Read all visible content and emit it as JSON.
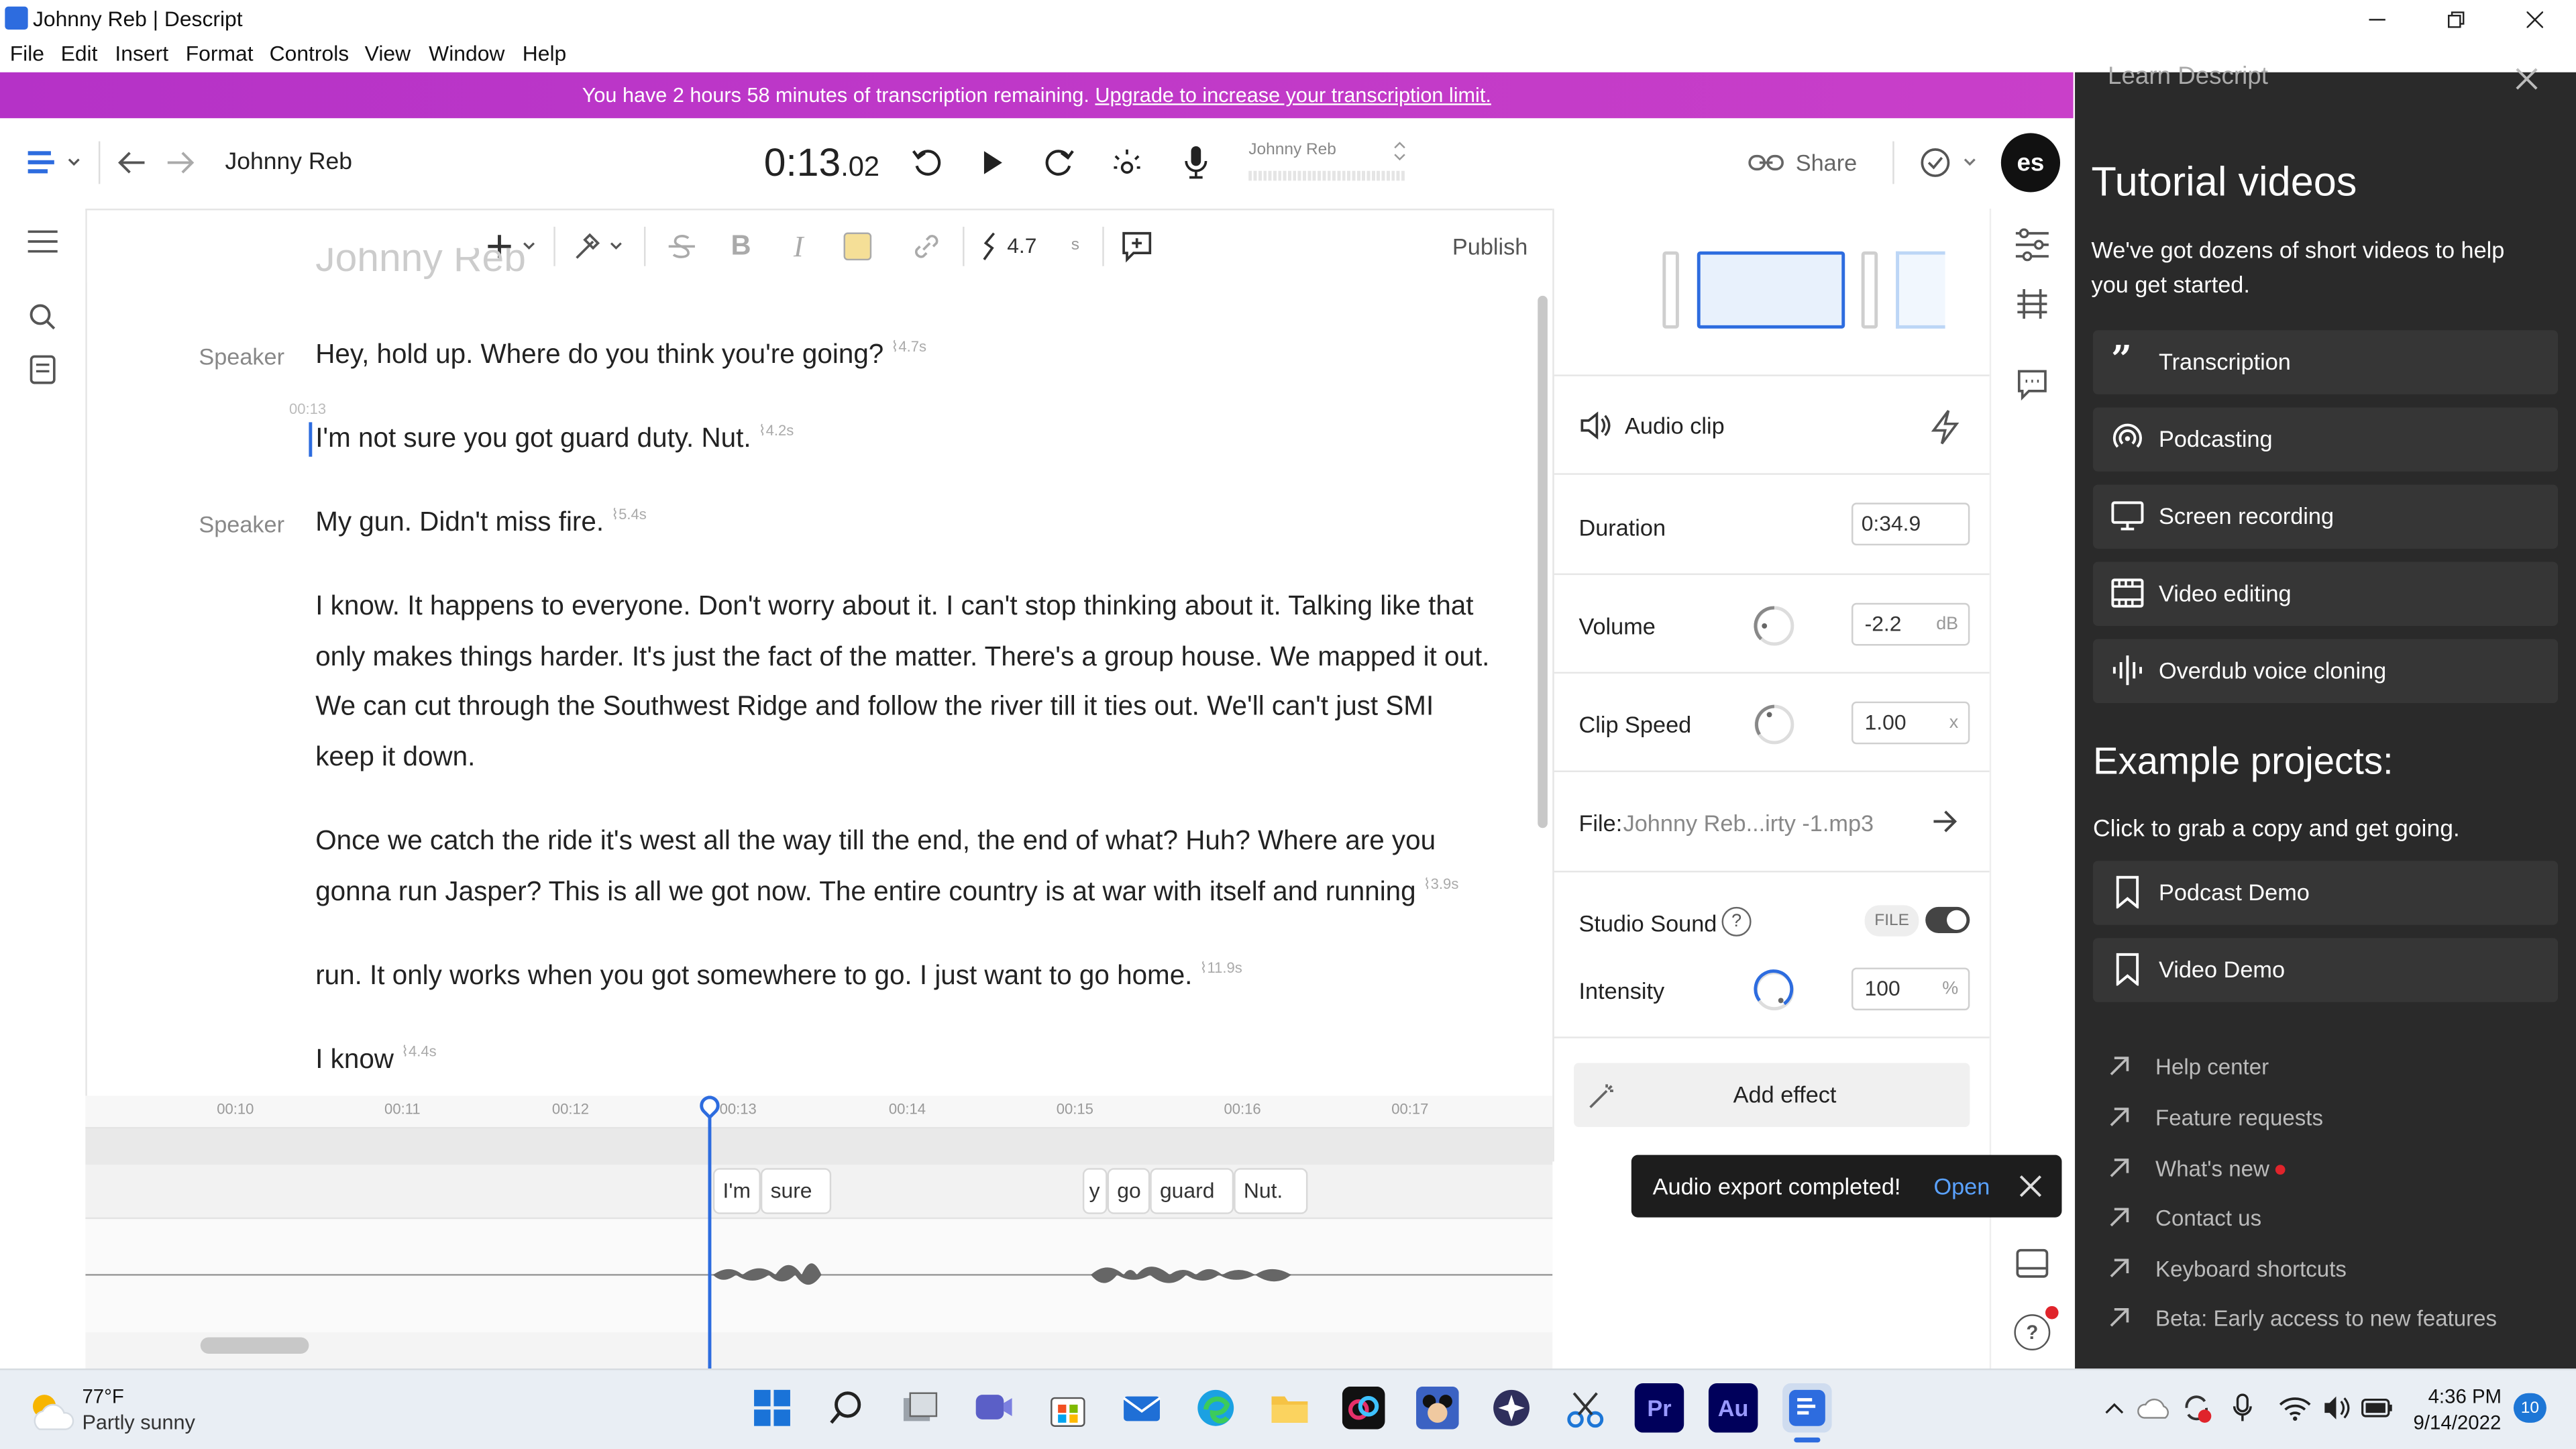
{
  "window": {
    "title": "Johnny Reb | Descript"
  },
  "menu": [
    "File",
    "Edit",
    "Insert",
    "Format",
    "Controls",
    "View",
    "Window",
    "Help"
  ],
  "banner": {
    "text": "You have 2 hours 58 minutes of transcription remaining.",
    "link": "Upgrade to increase your transcription limit."
  },
  "toolbar": {
    "project_title": "Johnny Reb",
    "time_main": "0:13",
    "time_frac": ".02",
    "speaker_select": "Johnny Reb",
    "share_label": "Share",
    "avatar_initials": "es"
  },
  "editor_toolbar": {
    "gap_value": "4.7",
    "gap_unit": "s",
    "publish_label": "Publish"
  },
  "editor": {
    "faded_title": "Johnny Reb",
    "timestamp": "00:13",
    "paragraphs": [
      {
        "speaker": "Speaker",
        "text": "Hey, hold up. Where do you think you're going?",
        "gap": "4.7s"
      },
      {
        "speaker": "",
        "text": "I'm not sure you got guard duty. Nut.",
        "gap": "4.2s"
      },
      {
        "speaker": "Speaker",
        "text": "My gun. Didn't miss fire.",
        "gap": "5.4s"
      },
      {
        "speaker": "",
        "text": "I know. It happens to everyone. Don't worry about it. I can't stop thinking about it. Talking like that only makes things harder. It's just the fact of the matter. There's a group house. We mapped it out. We can cut through the Southwest Ridge and follow the river till it ties out. We'll can't just SMI keep it down.",
        "gap": ""
      },
      {
        "speaker": "",
        "text": "Once we catch the ride it's west all the way till the end, the end of what? Huh? Where are you gonna run Jasper? This is all we got now. The entire country is at war with itself and running",
        "gap": "3.9s"
      },
      {
        "speaker": "",
        "text": "run. It only works when you got somewhere to go. I just want to go home.",
        "gap": "11.9s"
      },
      {
        "speaker": "",
        "text": "I know",
        "gap": "4.4s"
      }
    ]
  },
  "properties": {
    "section_title": "Audio clip",
    "duration_label": "Duration",
    "duration_value": "0:34.9",
    "volume_label": "Volume",
    "volume_value": "-2.2",
    "volume_unit": "dB",
    "speed_label": "Clip Speed",
    "speed_value": "1.00",
    "speed_unit": "x",
    "file_label": "File:",
    "file_name": "Johnny Reb...irty -1.mp3",
    "studio_label": "Studio Sound",
    "studio_badge": "FILE",
    "studio_on": true,
    "intensity_label": "Intensity",
    "intensity_value": "100",
    "intensity_unit": "%",
    "add_effect_label": "Add effect"
  },
  "toast": {
    "message": "Audio export completed!",
    "action": "Open"
  },
  "timeline": {
    "ticks": [
      "00:10",
      "00:11",
      "00:12",
      "00:13",
      "00:14",
      "00:15",
      "00:16",
      "00:17"
    ],
    "words": [
      "I'm",
      "sure",
      "y",
      "go",
      "guard",
      "Nut."
    ]
  },
  "learn": {
    "header": "Learn Descript",
    "tutorial_heading": "Tutorial videos",
    "tutorial_sub": "We've got dozens of short videos to help you get started.",
    "tutorials": [
      {
        "label": "Transcription",
        "icon": "quote-icon"
      },
      {
        "label": "Podcasting",
        "icon": "podcast-icon"
      },
      {
        "label": "Screen recording",
        "icon": "monitor-icon"
      },
      {
        "label": "Video editing",
        "icon": "film-icon"
      },
      {
        "label": "Overdub voice cloning",
        "icon": "waveform-icon"
      }
    ],
    "example_heading": "Example projects:",
    "example_sub": "Click to grab a copy and get going.",
    "examples": [
      "Podcast Demo",
      "Video Demo"
    ],
    "links": [
      "Help center",
      "Feature requests",
      "What's new",
      "Contact us",
      "Keyboard shortcuts",
      "Beta: Early access to new features"
    ]
  },
  "taskbar": {
    "weather_temp": "77°F",
    "weather_desc": "Partly sunny",
    "time": "4:36 PM",
    "date": "9/14/2022",
    "notification_count": "10",
    "apps": [
      "start",
      "search",
      "task-view",
      "teams",
      "store",
      "mail",
      "edge",
      "file-explorer",
      "creative-cloud",
      "disney",
      "app",
      "snipping",
      "Pr",
      "Au",
      "descript"
    ]
  },
  "colors": {
    "banner": "#c13ac8",
    "accent": "#2d6cdf",
    "learn_bg": "#2a2a2a"
  }
}
